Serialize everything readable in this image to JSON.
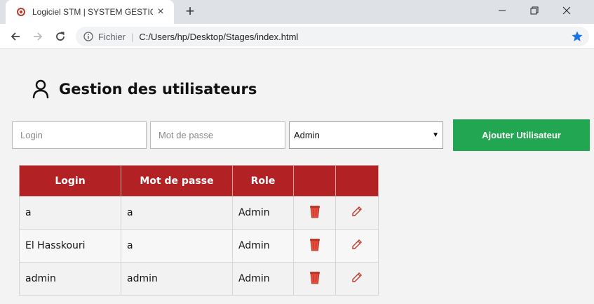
{
  "browser": {
    "tab_title": "Logiciel STM | SYSTEM GESTION",
    "omnibox_scheme": "Fichier",
    "omnibox_url": "C:/Users/hp/Desktop/Stages/index.html"
  },
  "page": {
    "title": "Gestion des utilisateurs"
  },
  "form": {
    "login_placeholder": "Login",
    "password_placeholder": "Mot de passe",
    "role_selected": "Admin",
    "add_button_label": "Ajouter Utilisateur"
  },
  "table": {
    "headers": [
      "Login",
      "Mot de passe",
      "Role"
    ],
    "rows": [
      {
        "login": "a",
        "password": "a",
        "role": "Admin"
      },
      {
        "login": "El Hasskouri",
        "password": "a",
        "role": "Admin"
      },
      {
        "login": "admin",
        "password": "admin",
        "role": "Admin"
      }
    ]
  },
  "colors": {
    "header_red": "#b22224",
    "add_green": "#22a652",
    "star_blue": "#1a73e8"
  }
}
